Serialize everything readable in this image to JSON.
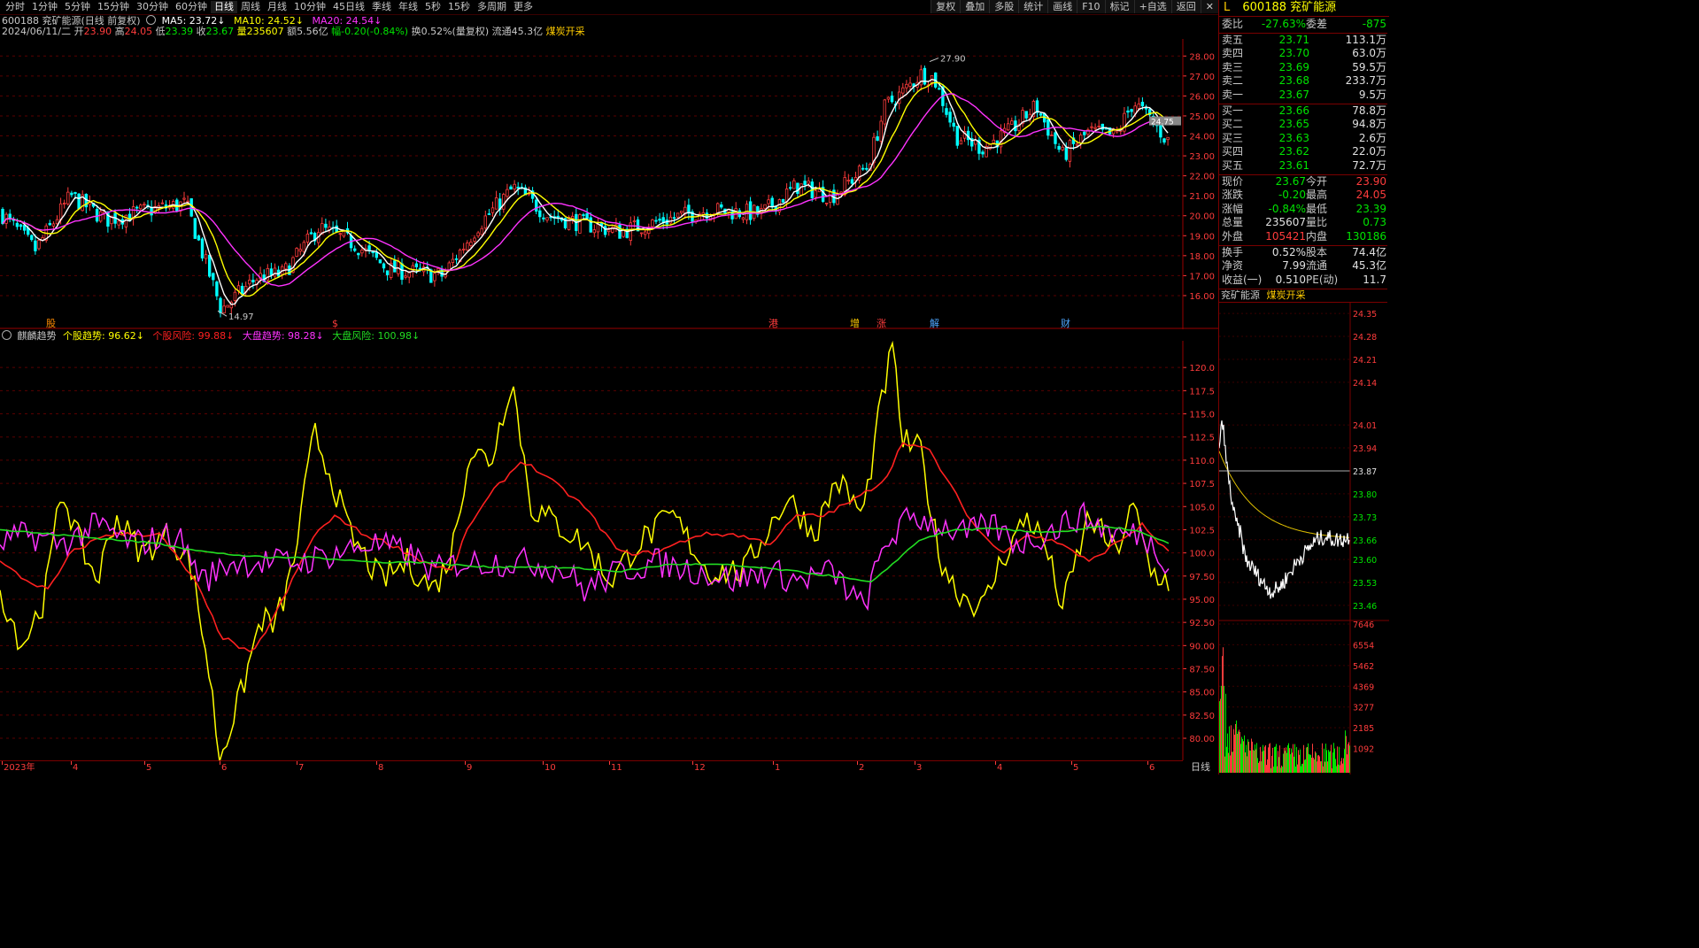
{
  "toolbar": {
    "periods": [
      "分时",
      "1分钟",
      "5分钟",
      "15分钟",
      "30分钟",
      "60分钟",
      "日线",
      "周线",
      "月线",
      "10分钟",
      "45日线",
      "季线",
      "年线",
      "5秒",
      "15秒",
      "多周期",
      "更多"
    ],
    "active_period": "日线",
    "tools": [
      "复权",
      "叠加",
      "多股",
      "统计",
      "画线",
      "F10",
      "标记",
      "+自选",
      "返回"
    ],
    "close_symbol": "✕"
  },
  "kline_header": {
    "title": "600188 兖矿能源(日线 前复权)",
    "ma5": "MA5: 23.72",
    "ma10": "MA10: 24.52",
    "ma20": "MA20: 24.54",
    "date": "2024/06/11/二",
    "open_label": "开",
    "open": "23.90",
    "high_label": "高",
    "high": "24.05",
    "low_label": "低",
    "low": "23.39",
    "close_label": "收",
    "close": "23.67",
    "vol": "量235607",
    "amount": "额5.56亿",
    "change": "幅-0.20(-0.84%)",
    "turnover": "换0.52%(量复权)",
    "float_cap": "流通45.3亿",
    "sector": "煤炭开采"
  },
  "kline_axis": [
    "28.00",
    "27.00",
    "26.00",
    "25.00",
    "24.00",
    "23.00",
    "22.00",
    "21.00",
    "20.00",
    "19.00",
    "18.00",
    "17.00",
    "16.00"
  ],
  "kline_annotations": {
    "max_label": "27.90",
    "min_label": "14.97",
    "last_label": "24.75"
  },
  "event_markers": [
    {
      "text": "股",
      "color": "#ff8c00"
    },
    {
      "text": "$",
      "color": "#ff3c3c"
    },
    {
      "text": "港",
      "color": "#ff3c3c"
    },
    {
      "text": "增",
      "color": "#ffcc00"
    },
    {
      "text": "涨",
      "color": "#ff3c3c"
    },
    {
      "text": "解",
      "color": "#4da6ff"
    },
    {
      "text": "财",
      "color": "#4da6ff"
    }
  ],
  "indicator_header": {
    "name": "麒麟趋势",
    "s1": "个股趋势: 96.62",
    "s2": "个股风险: 99.88",
    "s3": "大盘趋势: 98.28",
    "s4": "大盘风险: 100.98"
  },
  "indicator_axis": [
    "120.0",
    "117.5",
    "115.0",
    "112.5",
    "110.0",
    "107.5",
    "105.0",
    "102.5",
    "100.0",
    "97.50",
    "95.00",
    "92.50",
    "90.00",
    "87.50",
    "85.00",
    "82.50",
    "80.00"
  ],
  "date_axis": [
    "2023年",
    "4",
    "5",
    "6",
    "7",
    "8",
    "9",
    "10",
    "11",
    "12",
    "1",
    "2",
    "3",
    "4",
    "5",
    "6"
  ],
  "bottom_period": "日线",
  "colors": {
    "up": "#ff3c3c",
    "down": "#00ffff",
    "ma5": "#ffffff",
    "ma10": "#ffff00",
    "ma20": "#ff33ff",
    "ind_yellow": "#ffff00",
    "ind_red": "#ff2020",
    "ind_magenta": "#ff33ff",
    "ind_green": "#22dd22",
    "grid": "#5a0000"
  },
  "quote": {
    "code_prefix": "L",
    "code": "600188",
    "name": "兖矿能源",
    "weibi_label": "委比",
    "weibi": "-27.63%",
    "weicha_label": "委差",
    "weicha": "-875",
    "asks": [
      {
        "label": "卖五",
        "price": "23.71",
        "vol": "113.1万"
      },
      {
        "label": "卖四",
        "price": "23.70",
        "vol": "63.0万"
      },
      {
        "label": "卖三",
        "price": "23.69",
        "vol": "59.5万"
      },
      {
        "label": "卖二",
        "price": "23.68",
        "vol": "233.7万"
      },
      {
        "label": "卖一",
        "price": "23.67",
        "vol": "9.5万"
      }
    ],
    "bids": [
      {
        "label": "买一",
        "price": "23.66",
        "vol": "78.8万"
      },
      {
        "label": "买二",
        "price": "23.65",
        "vol": "94.8万"
      },
      {
        "label": "买三",
        "price": "23.63",
        "vol": "2.6万"
      },
      {
        "label": "买四",
        "price": "23.62",
        "vol": "22.0万"
      },
      {
        "label": "买五",
        "price": "23.61",
        "vol": "72.7万"
      }
    ],
    "stats": [
      {
        "l1": "现价",
        "v1": "23.67",
        "c1": "g",
        "l2": "今开",
        "v2": "23.90",
        "c2": "r"
      },
      {
        "l1": "涨跌",
        "v1": "-0.20",
        "c1": "g",
        "l2": "最高",
        "v2": "24.05",
        "c2": "r"
      },
      {
        "l1": "涨幅",
        "v1": "-0.84%",
        "c1": "g",
        "l2": "最低",
        "v2": "23.39",
        "c2": "g"
      },
      {
        "l1": "总量",
        "v1": "235607",
        "c1": "w",
        "l2": "量比",
        "v2": "0.73",
        "c2": "g"
      },
      {
        "l1": "外盘",
        "v1": "105421",
        "c1": "r",
        "l2": "内盘",
        "v2": "130186",
        "c2": "g"
      }
    ],
    "stats2": [
      {
        "l1": "换手",
        "v1": "0.52%",
        "l2": "股本",
        "v2": "74.4亿"
      },
      {
        "l1": "净资",
        "v1": "7.99",
        "l2": "流通",
        "v2": "45.3亿"
      },
      {
        "l1": "收益(一)",
        "v1": "0.510",
        "l2": "PE(动)",
        "v2": "11.7"
      }
    ],
    "mini_title": "兖矿能源",
    "mini_sector": "煤炭开采"
  },
  "mini_axis": [
    "24.35",
    "24.28",
    "24.21",
    "24.14",
    "24.01",
    "23.94",
    "23.87",
    "23.80",
    "23.73",
    "23.66",
    "23.60",
    "23.53",
    "23.46"
  ],
  "mini_vol_axis": [
    "7646",
    "6554",
    "5462",
    "4369",
    "3277",
    "2185",
    "1092"
  ]
}
